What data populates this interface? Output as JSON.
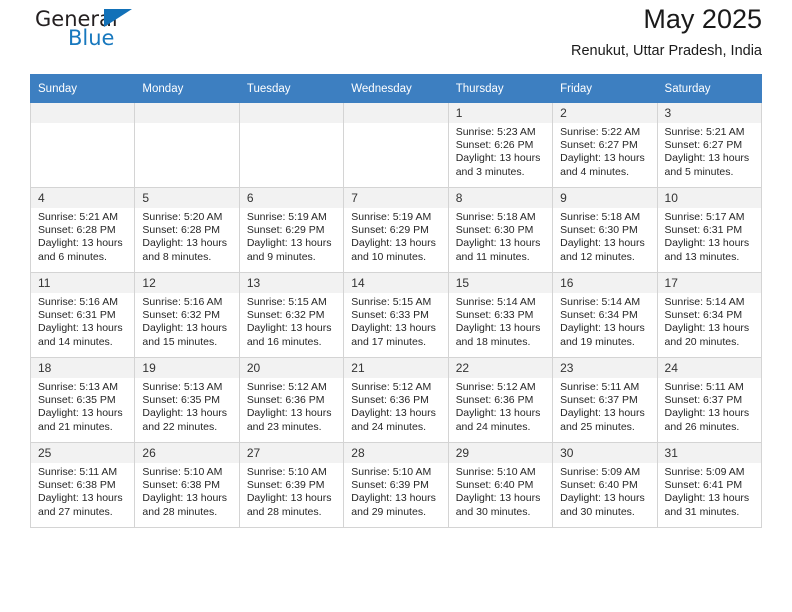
{
  "brand": {
    "name_top": "General",
    "name_bottom": "Blue",
    "accent_color": "#1271b8",
    "text_color": "#231f20"
  },
  "header": {
    "title": "May 2025",
    "subtitle": "Renukut, Uttar Pradesh, India"
  },
  "calendar": {
    "header_bg": "#3d7fc1",
    "daynum_bg": "#f2f2f2",
    "weekdays": [
      "Sunday",
      "Monday",
      "Tuesday",
      "Wednesday",
      "Thursday",
      "Friday",
      "Saturday"
    ],
    "labels": {
      "sunrise": "Sunrise:",
      "sunset": "Sunset:",
      "daylight": "Daylight:"
    },
    "weeks": [
      [
        {
          "day": "",
          "empty": true
        },
        {
          "day": "",
          "empty": true
        },
        {
          "day": "",
          "empty": true
        },
        {
          "day": "",
          "empty": true
        },
        {
          "day": "1",
          "sunrise": "Sunrise: 5:23 AM",
          "sunset": "Sunset: 6:26 PM",
          "daylight_1": "Daylight: 13 hours",
          "daylight_2": "and 3 minutes."
        },
        {
          "day": "2",
          "sunrise": "Sunrise: 5:22 AM",
          "sunset": "Sunset: 6:27 PM",
          "daylight_1": "Daylight: 13 hours",
          "daylight_2": "and 4 minutes."
        },
        {
          "day": "3",
          "sunrise": "Sunrise: 5:21 AM",
          "sunset": "Sunset: 6:27 PM",
          "daylight_1": "Daylight: 13 hours",
          "daylight_2": "and 5 minutes."
        }
      ],
      [
        {
          "day": "4",
          "sunrise": "Sunrise: 5:21 AM",
          "sunset": "Sunset: 6:28 PM",
          "daylight_1": "Daylight: 13 hours",
          "daylight_2": "and 6 minutes."
        },
        {
          "day": "5",
          "sunrise": "Sunrise: 5:20 AM",
          "sunset": "Sunset: 6:28 PM",
          "daylight_1": "Daylight: 13 hours",
          "daylight_2": "and 8 minutes."
        },
        {
          "day": "6",
          "sunrise": "Sunrise: 5:19 AM",
          "sunset": "Sunset: 6:29 PM",
          "daylight_1": "Daylight: 13 hours",
          "daylight_2": "and 9 minutes."
        },
        {
          "day": "7",
          "sunrise": "Sunrise: 5:19 AM",
          "sunset": "Sunset: 6:29 PM",
          "daylight_1": "Daylight: 13 hours",
          "daylight_2": "and 10 minutes."
        },
        {
          "day": "8",
          "sunrise": "Sunrise: 5:18 AM",
          "sunset": "Sunset: 6:30 PM",
          "daylight_1": "Daylight: 13 hours",
          "daylight_2": "and 11 minutes."
        },
        {
          "day": "9",
          "sunrise": "Sunrise: 5:18 AM",
          "sunset": "Sunset: 6:30 PM",
          "daylight_1": "Daylight: 13 hours",
          "daylight_2": "and 12 minutes."
        },
        {
          "day": "10",
          "sunrise": "Sunrise: 5:17 AM",
          "sunset": "Sunset: 6:31 PM",
          "daylight_1": "Daylight: 13 hours",
          "daylight_2": "and 13 minutes."
        }
      ],
      [
        {
          "day": "11",
          "sunrise": "Sunrise: 5:16 AM",
          "sunset": "Sunset: 6:31 PM",
          "daylight_1": "Daylight: 13 hours",
          "daylight_2": "and 14 minutes."
        },
        {
          "day": "12",
          "sunrise": "Sunrise: 5:16 AM",
          "sunset": "Sunset: 6:32 PM",
          "daylight_1": "Daylight: 13 hours",
          "daylight_2": "and 15 minutes."
        },
        {
          "day": "13",
          "sunrise": "Sunrise: 5:15 AM",
          "sunset": "Sunset: 6:32 PM",
          "daylight_1": "Daylight: 13 hours",
          "daylight_2": "and 16 minutes."
        },
        {
          "day": "14",
          "sunrise": "Sunrise: 5:15 AM",
          "sunset": "Sunset: 6:33 PM",
          "daylight_1": "Daylight: 13 hours",
          "daylight_2": "and 17 minutes."
        },
        {
          "day": "15",
          "sunrise": "Sunrise: 5:14 AM",
          "sunset": "Sunset: 6:33 PM",
          "daylight_1": "Daylight: 13 hours",
          "daylight_2": "and 18 minutes."
        },
        {
          "day": "16",
          "sunrise": "Sunrise: 5:14 AM",
          "sunset": "Sunset: 6:34 PM",
          "daylight_1": "Daylight: 13 hours",
          "daylight_2": "and 19 minutes."
        },
        {
          "day": "17",
          "sunrise": "Sunrise: 5:14 AM",
          "sunset": "Sunset: 6:34 PM",
          "daylight_1": "Daylight: 13 hours",
          "daylight_2": "and 20 minutes."
        }
      ],
      [
        {
          "day": "18",
          "sunrise": "Sunrise: 5:13 AM",
          "sunset": "Sunset: 6:35 PM",
          "daylight_1": "Daylight: 13 hours",
          "daylight_2": "and 21 minutes."
        },
        {
          "day": "19",
          "sunrise": "Sunrise: 5:13 AM",
          "sunset": "Sunset: 6:35 PM",
          "daylight_1": "Daylight: 13 hours",
          "daylight_2": "and 22 minutes."
        },
        {
          "day": "20",
          "sunrise": "Sunrise: 5:12 AM",
          "sunset": "Sunset: 6:36 PM",
          "daylight_1": "Daylight: 13 hours",
          "daylight_2": "and 23 minutes."
        },
        {
          "day": "21",
          "sunrise": "Sunrise: 5:12 AM",
          "sunset": "Sunset: 6:36 PM",
          "daylight_1": "Daylight: 13 hours",
          "daylight_2": "and 24 minutes."
        },
        {
          "day": "22",
          "sunrise": "Sunrise: 5:12 AM",
          "sunset": "Sunset: 6:36 PM",
          "daylight_1": "Daylight: 13 hours",
          "daylight_2": "and 24 minutes."
        },
        {
          "day": "23",
          "sunrise": "Sunrise: 5:11 AM",
          "sunset": "Sunset: 6:37 PM",
          "daylight_1": "Daylight: 13 hours",
          "daylight_2": "and 25 minutes."
        },
        {
          "day": "24",
          "sunrise": "Sunrise: 5:11 AM",
          "sunset": "Sunset: 6:37 PM",
          "daylight_1": "Daylight: 13 hours",
          "daylight_2": "and 26 minutes."
        }
      ],
      [
        {
          "day": "25",
          "sunrise": "Sunrise: 5:11 AM",
          "sunset": "Sunset: 6:38 PM",
          "daylight_1": "Daylight: 13 hours",
          "daylight_2": "and 27 minutes."
        },
        {
          "day": "26",
          "sunrise": "Sunrise: 5:10 AM",
          "sunset": "Sunset: 6:38 PM",
          "daylight_1": "Daylight: 13 hours",
          "daylight_2": "and 28 minutes."
        },
        {
          "day": "27",
          "sunrise": "Sunrise: 5:10 AM",
          "sunset": "Sunset: 6:39 PM",
          "daylight_1": "Daylight: 13 hours",
          "daylight_2": "and 28 minutes."
        },
        {
          "day": "28",
          "sunrise": "Sunrise: 5:10 AM",
          "sunset": "Sunset: 6:39 PM",
          "daylight_1": "Daylight: 13 hours",
          "daylight_2": "and 29 minutes."
        },
        {
          "day": "29",
          "sunrise": "Sunrise: 5:10 AM",
          "sunset": "Sunset: 6:40 PM",
          "daylight_1": "Daylight: 13 hours",
          "daylight_2": "and 30 minutes."
        },
        {
          "day": "30",
          "sunrise": "Sunrise: 5:09 AM",
          "sunset": "Sunset: 6:40 PM",
          "daylight_1": "Daylight: 13 hours",
          "daylight_2": "and 30 minutes."
        },
        {
          "day": "31",
          "sunrise": "Sunrise: 5:09 AM",
          "sunset": "Sunset: 6:41 PM",
          "daylight_1": "Daylight: 13 hours",
          "daylight_2": "and 31 minutes."
        }
      ]
    ]
  }
}
